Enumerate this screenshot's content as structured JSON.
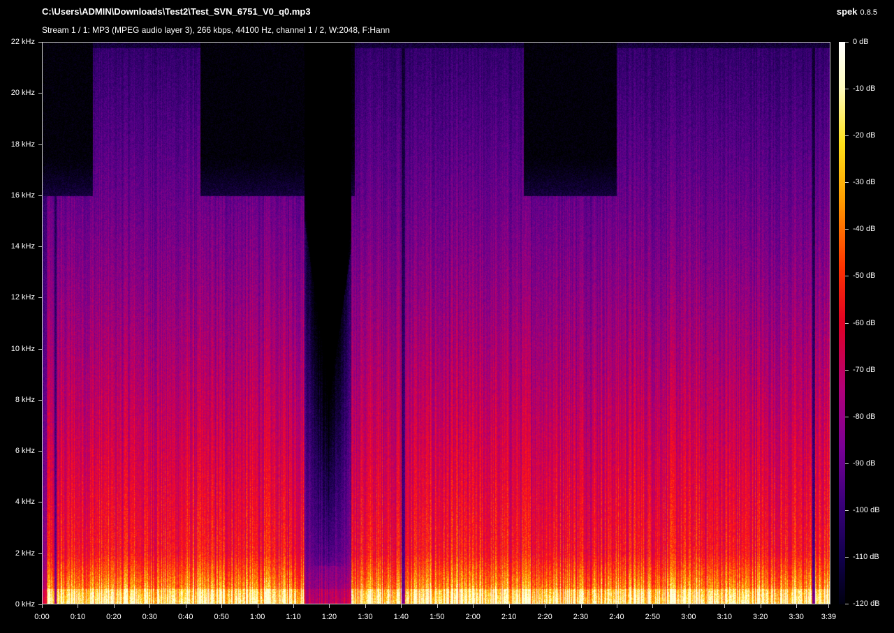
{
  "window": {
    "file_path": "C:\\Users\\ADMIN\\Downloads\\Test2\\Test_SVN_6751_V0_q0.mp3",
    "app_name": "spek",
    "app_version": "0.8.5",
    "stream_info": "Stream 1 / 1: MP3 (MPEG audio layer 3), 266 kbps, 44100 Hz, channel 1 / 2, W:2048, F:Hann"
  },
  "y_axis": {
    "labels": [
      "22 kHz",
      "20 kHz",
      "18 kHz",
      "16 kHz",
      "14 kHz",
      "12 kHz",
      "10 kHz",
      "8 kHz",
      "6 kHz",
      "4 kHz",
      "2 kHz",
      "0 kHz"
    ],
    "values_khz": [
      22,
      20,
      18,
      16,
      14,
      12,
      10,
      8,
      6,
      4,
      2,
      0
    ]
  },
  "x_axis": {
    "labels": [
      "0:00",
      "0:10",
      "0:20",
      "0:30",
      "0:40",
      "0:50",
      "1:00",
      "1:10",
      "1:20",
      "1:30",
      "1:40",
      "1:50",
      "2:00",
      "2:10",
      "2:20",
      "2:30",
      "2:40",
      "2:50",
      "3:00",
      "3:10",
      "3:20",
      "3:30",
      "3:39"
    ],
    "values_s": [
      0,
      10,
      20,
      30,
      40,
      50,
      60,
      70,
      80,
      90,
      100,
      110,
      120,
      130,
      140,
      150,
      160,
      170,
      180,
      190,
      200,
      210,
      219
    ]
  },
  "color_scale": {
    "labels": [
      "0 dB",
      "-10 dB",
      "-20 dB",
      "-30 dB",
      "-40 dB",
      "-50 dB",
      "-60 dB",
      "-70 dB",
      "-80 dB",
      "-90 dB",
      "-100 dB",
      "-110 dB",
      "-120 dB"
    ],
    "values_db": [
      0,
      -10,
      -20,
      -30,
      -40,
      -50,
      -60,
      -70,
      -80,
      -90,
      -100,
      -110,
      -120
    ]
  }
}
